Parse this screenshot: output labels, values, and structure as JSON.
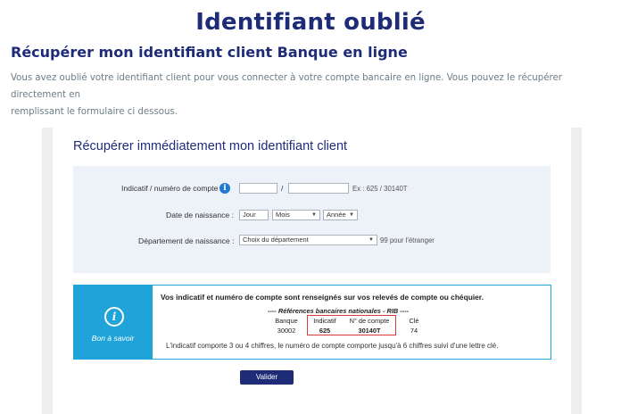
{
  "header": {
    "title": "Identifiant oublié",
    "subtitle": "Récupérer mon identifiant client Banque en ligne",
    "intro_line1": "Vous avez oublié votre identifiant client pour vous connecter à votre compte bancaire en ligne. Vous pouvez le récupérer directement en",
    "intro_line2": "remplissant le formulaire ci dessous."
  },
  "form": {
    "title": "Récupérer immédiatement mon identifiant client",
    "account": {
      "label": "Indicatif / numéro de compte",
      "separator": "/",
      "hint": "Ex : 625 / 30140T",
      "indicatif_value": "",
      "numero_value": ""
    },
    "birthdate": {
      "label": "Date de naissance :",
      "day": "Jour",
      "month": "Mois",
      "year": "Année"
    },
    "department": {
      "label": "Département de naissance :",
      "selected": "Choix du département",
      "hint": "99 pour l'étranger"
    },
    "submit_label": "Valider"
  },
  "info_box": {
    "label": "Bon à savoir",
    "headline": "Vos indicatif et numéro de compte sont renseignés sur vos relevés de compte ou chéquier.",
    "rib_title": "---- Références bancaires nationales - RIB ----",
    "rib_headers": [
      "Banque",
      "Indicatif",
      "N° de compte",
      "Clé"
    ],
    "rib_values": [
      "30002",
      "625",
      "30140T",
      "74"
    ],
    "note": "L'indicatif comporte 3 ou 4 chiffres, le numéro de compte comporte jusqu'à 6 chiffres suivi d'une lettre clé."
  },
  "colors": {
    "brand_navy": "#1e2c78",
    "info_blue": "#1fa3d9",
    "form_bg": "#edf1f8",
    "highlight_red": "#d63a3a"
  },
  "icons": {
    "field_info": "info-icon",
    "bon_a_savoir": "info-circle-icon"
  }
}
